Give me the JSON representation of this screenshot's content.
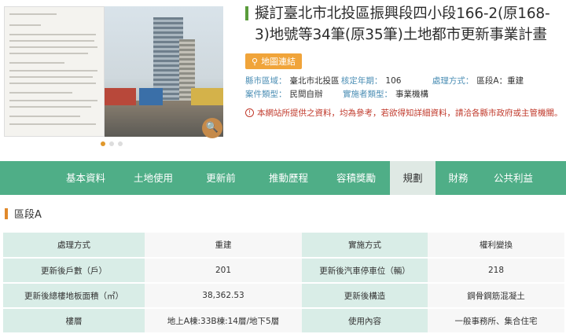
{
  "project": {
    "title": "擬訂臺北市北投區振興段四小段166-2(原168-3)地號等34筆(原35筆)土地都市更新事業計畫",
    "map_link": "地圖連結"
  },
  "meta": [
    [
      {
        "k": "縣市區域：",
        "v": "臺北市北投區"
      },
      {
        "k": "核定年期：",
        "v": "106"
      },
      {
        "k": "處理方式：",
        "v": "區段A：重建"
      }
    ],
    [
      {
        "k": "案件類型：",
        "v": "民間自辦"
      },
      {
        "k": "實施者類型：",
        "v": "事業機構"
      },
      {
        "k": "",
        "v": ""
      }
    ]
  ],
  "notice": "本網站所提供之資料，均為參考，若欲得知詳細資料，請洽各縣市政府或主管機關。",
  "tabs": [
    {
      "label": "基本資料",
      "w": 86
    },
    {
      "label": "土地使用",
      "w": 86
    },
    {
      "label": "更新前",
      "w": 86
    },
    {
      "label": "推動歷程",
      "w": 86
    },
    {
      "label": "容積獎勵",
      "w": 86
    },
    {
      "label": "規劃",
      "w": 58,
      "active": true
    },
    {
      "label": "財務",
      "w": 58
    },
    {
      "label": "公共利益",
      "w": 82
    }
  ],
  "section_title": "區段A",
  "table": [
    [
      "處理方式",
      "重建",
      "實施方式",
      "權利變換"
    ],
    [
      "更新後戶數（戶）",
      "201",
      "更新後汽車停車位（輛）",
      "218"
    ],
    [
      "更新後總樓地板面積（㎡）",
      "38,362.53",
      "更新後構造",
      "鋼骨鋼筋混凝土"
    ],
    [
      "樓層",
      "地上A棟:33B棟:14層/地下5層",
      "使用內容",
      "一般事務所、集合住宅"
    ]
  ]
}
